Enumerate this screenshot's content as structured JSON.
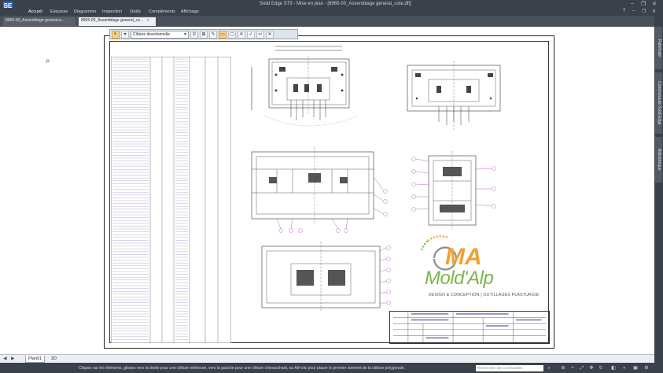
{
  "app": {
    "icon_label": "SE",
    "title": "Solid Edge ST9 - Mise en plan - [8965-00_Assemblage general_cote.dft]",
    "window_controls": [
      "–",
      "❐",
      "✕"
    ]
  },
  "ribbon": {
    "tabs": [
      "Accueil",
      "Esquisse",
      "Diagramme",
      "Inspection",
      "Outils",
      "Compléments",
      "Affichage"
    ],
    "active_tab": "Accueil",
    "right_controls": [
      "?",
      "–",
      "❐",
      "✕"
    ]
  },
  "document_tabs": [
    {
      "label": "8965-00_Assemblage general.a...",
      "active": false
    },
    {
      "label": "8965-00_Assemblage general_co...",
      "active": true
    }
  ],
  "command_bar": {
    "select_value": "Clôture directionnelle",
    "icons": [
      "select-arrow-icon",
      "options-icon",
      "filter-icon",
      "select-all-icon",
      "brush-icon",
      "window-icon",
      "rectangle-icon",
      "clear-icon",
      "accept-icon",
      "back-icon",
      "close-icon"
    ]
  },
  "right_panel": {
    "tabs": [
      "Pathfinder",
      "Communauté Solid Edge",
      "Bibliothèque"
    ]
  },
  "sheet_tabs": {
    "nav": [
      "◀",
      "▶"
    ],
    "tabs": [
      {
        "label": "Plan01",
        "active": true
      },
      {
        "label": "2D",
        "active": false
      }
    ]
  },
  "logo": {
    "brand_text": "Mold'Alp",
    "mark_text": "MA",
    "tagline": "DESIGN & CONCEPTION | OUTILLAGES PLASTURGIE",
    "colors": {
      "green": "#7ab648",
      "orange": "#f0a032",
      "gray": "#8a8f96"
    }
  },
  "status_bar": {
    "message": "Cliquez sur les éléments, glissez vers la droite pour une clôture intérieure, vers la gauche pour une clôture chevauchant, ou Alt+clic pour placer le premier sommet de la clôture polygonale.",
    "search_placeholder": "Rechercher des commandes"
  },
  "colors": {
    "chrome": "#3b414b",
    "accent_blue": "#2f6bd0",
    "balloon_purple": "#9a4fb0"
  }
}
